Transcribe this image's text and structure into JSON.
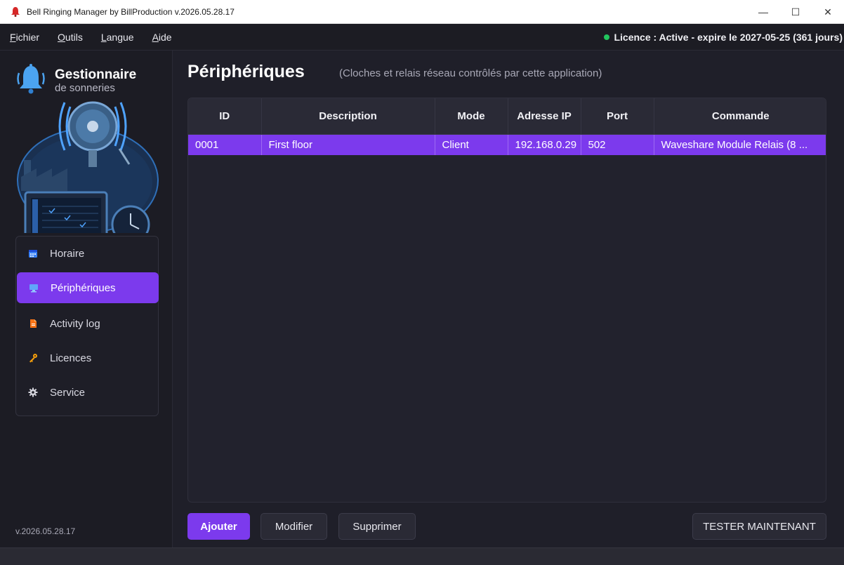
{
  "window": {
    "title": "Bell Ringing Manager by BillProduction  v.2026.05.28.17",
    "minimize": "—",
    "maximize": "☐",
    "close": "✕"
  },
  "menu": {
    "items": [
      {
        "first": "F",
        "rest": "ichier"
      },
      {
        "first": "O",
        "rest": "utils"
      },
      {
        "first": "L",
        "rest": "angue"
      },
      {
        "first": "A",
        "rest": "ide"
      }
    ],
    "license_text": "Licence : Active - expire le 2027-05-25 (361 jours)",
    "license_color": "#22c55e"
  },
  "sidebar": {
    "brand_title": "Gestionnaire",
    "brand_subtitle": "de sonneries",
    "items": [
      {
        "label": "Horaire",
        "icon": "calendar-icon"
      },
      {
        "label": "Périphériques",
        "icon": "monitor-icon"
      },
      {
        "label": "Activity log",
        "icon": "document-icon"
      },
      {
        "label": "Licences",
        "icon": "key-icon"
      },
      {
        "label": "Service",
        "icon": "gear-icon"
      }
    ],
    "active_index": 1,
    "version": "v.2026.05.28.17"
  },
  "main": {
    "title": "Périphériques",
    "subtitle": "(Cloches et relais réseau contrôlés par cette application)",
    "table": {
      "columns": [
        "ID",
        "Description",
        "Mode",
        "Adresse IP",
        "Port",
        "Commande"
      ],
      "rows": [
        [
          "0001",
          "First floor",
          "Client",
          "192.168.0.29",
          "502",
          "Waveshare Module Relais (8 ..."
        ]
      ]
    },
    "buttons": {
      "add": "Ajouter",
      "edit": "Modifier",
      "delete": "Supprimer",
      "test": "TESTER MAINTENANT"
    }
  },
  "colors": {
    "accent": "#7c3aed",
    "background": "#1f1f29"
  }
}
